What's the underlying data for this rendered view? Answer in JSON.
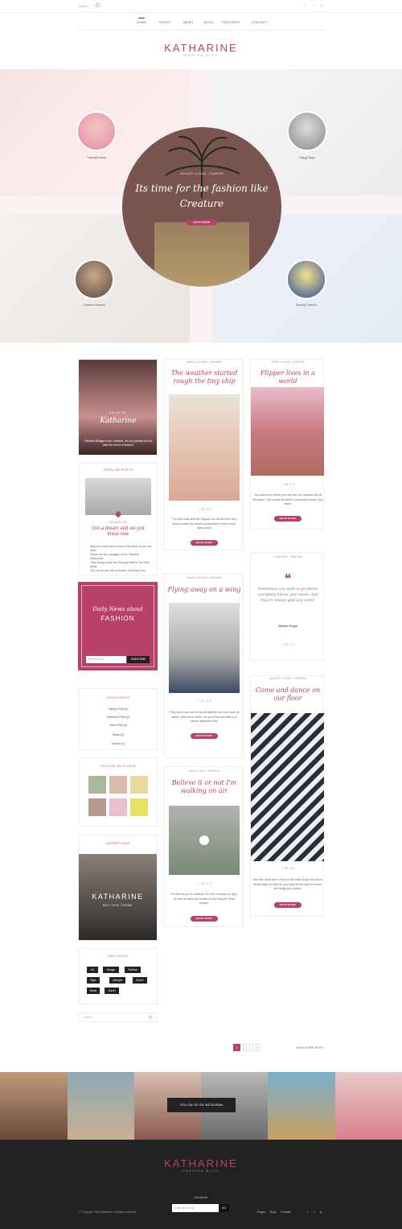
{
  "topbar": {
    "search_label": "Search",
    "social": [
      "f",
      "t",
      "g"
    ]
  },
  "nav": {
    "items": [
      "HOME",
      "PAGES",
      "NEWS",
      "BLOG",
      "FEATURES",
      "CONTACT"
    ]
  },
  "logo": {
    "name_part1": "KAT",
    "name_a": "H",
    "name_part2": "ARINE",
    "tagline": "FASHION BLOG"
  },
  "hero": {
    "thumbs": [
      {
        "caption": "Travelled down"
      },
      {
        "caption": "Happy Days"
      },
      {
        "caption": "Creators Fashion"
      },
      {
        "caption": "Dummy Fashion"
      }
    ],
    "meta": "AUGUST 14 2015 - FASHION",
    "title": "Its time for the fashion like Creature",
    "button": "READ MORE"
  },
  "sidebar": {
    "about": {
      "label": "ABOUT ME",
      "name": "Katharine",
      "text": "Fashion Blogger from Canada, it's my passion to live with the trend of fashion"
    },
    "popular": {
      "title": "POPULAR POSTS",
      "meta": "FASHION LIFE",
      "headline": "Got a dream and we just know now",
      "items": [
        "Now the world don't move to the beat of just one drum",
        "These are the voyages of the Starship Enterprise",
        "Then along come two they got nothin' but their jeans",
        "The movie star the professor and Mary Ann"
      ]
    },
    "newsletter": {
      "title": "Daily News about",
      "title2": "FASHION",
      "placeholder": "Enter E-mail",
      "button": "SUBSCRIBE"
    },
    "categories": {
      "title": "CATEGORIES",
      "items": [
        "Gallery Post (4)",
        "Standard Post (2)",
        "Video Post (2)",
        "News (2)",
        "Quotes (2)"
      ]
    },
    "flickr": {
      "title": "FOLLOW ON FLICKR"
    },
    "ad": {
      "title": "ADVERTISING",
      "logo": "KATHARINE",
      "sub": "BUY THIS THEME"
    },
    "tags": {
      "title": "TAG CLOUD",
      "items": [
        "Art",
        "Design",
        "Fashion",
        "Style",
        "Lifestyle",
        "Model",
        "News",
        "Travel"
      ]
    },
    "search_placeholder": "Search"
  },
  "posts": {
    "p1": {
      "meta": "MARCH 14 2015 - FASHION",
      "title": "The weather started rough the tiny ship",
      "likes": "16",
      "comments": "0",
      "text": "The first mate and his Skipper too will do their very best to make the others comfortable in their tropic island nest!",
      "button": "READ MORE"
    },
    "p2": {
      "meta": "APRIL 14 2015 - FASHION",
      "title": "Flipper lives in a world",
      "likes": "15",
      "comments": "3",
      "text": "You wanna be where you can see our troubles are all the same. You wanna be where everybody knows Your name.",
      "button": "READ MORE"
    },
    "p3": {
      "meta": "MARCH 14 2015 - FASHION",
      "title": "Flying away on a wing",
      "likes": "17",
      "comments": "3",
      "text": "They were four men living all together yet they were all alone. Well we're movin' on up to the east side to a deluxe apartment sky.",
      "button": "READ MORE"
    },
    "p4": {
      "meta": "1 DAY AGO - FASHION",
      "quote": "Sometimes you want to go where everybody knows your name. And they're always glad you came!",
      "author": "William Regal",
      "likes": "10",
      "comments": "2"
    },
    "p5": {
      "meta": "AUGUST 14 2015 - FASHION",
      "title": "Come and dance on our floor",
      "likes": "24",
      "comments": "0",
      "text": "Now the world don't move to the beat of just one drum. What might be right for you may not be right for some. We finally got a piece.",
      "button": "READ MORE"
    },
    "p6": {
      "meta": "MAY 21 2015 - FASHION",
      "title": "Believe it or not I'm walking on air",
      "likes": "15",
      "comments": "0",
      "text": "It's time to put on makeup. It's time to dress up right. It's time to raise the curtain on the Muppet Show tonight.",
      "button": "READ MORE"
    }
  },
  "pagination": {
    "pages": [
      "1",
      "2",
      "3"
    ],
    "view_more": "VIEW MORE POST"
  },
  "instagram": {
    "label": "FOLLOW US ON INSTAGRAM"
  },
  "footer": {
    "logo1": "KAT",
    "logo2": "H",
    "logo3": "ARINE",
    "tagline": "FASHION BLOG",
    "copyright": "© Copyright 2016 Katharine. All rights reserved",
    "newsletter_label": "Newsletter",
    "newsletter_placeholder": "Enter Your E-mail",
    "go": "GO",
    "links": [
      "Pages",
      "Blog",
      "Contact"
    ],
    "social": [
      "f",
      "t",
      "g"
    ]
  },
  "colors": {
    "accent": "#b8406b",
    "dark": "#222222"
  }
}
